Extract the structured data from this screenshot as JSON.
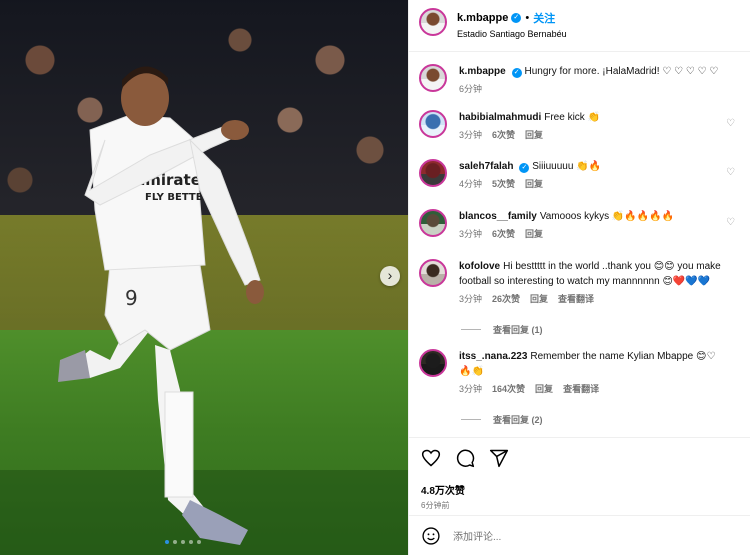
{
  "post": {
    "author": "k.mbappe",
    "follow_label": "关注",
    "separator": "•",
    "location": "Estadio Santiago Bernabéu",
    "caption": "Hungry for more. ¡HalaMadrid! ♡ ♡ ♡ ♡ ♡",
    "caption_time": "6分钟"
  },
  "comments": [
    {
      "user": "habibialmahmudi",
      "verified": false,
      "text": "Free kick 👏",
      "time": "3分钟",
      "likes": "6次赞",
      "reply": "回复"
    },
    {
      "user": "saleh7falah",
      "verified": true,
      "text": "Siiiuuuuu 👏🔥",
      "time": "4分钟",
      "likes": "5次赞",
      "reply": "回复"
    },
    {
      "user": "blancos__family",
      "verified": false,
      "text": "Vamooos kykys 👏🔥🔥🔥🔥",
      "time": "3分钟",
      "likes": "6次赞",
      "reply": "回复"
    },
    {
      "user": "kofolove",
      "verified": false,
      "text": "Hi besttttt in the world ..thank you 😊😊 you make football so interesting to watch my mannnnnn 😊❤️💙💙",
      "time": "3分钟",
      "likes": "26次赞",
      "reply": "回复",
      "translate": "查看翻译",
      "view_replies": "查看回复 (1)"
    },
    {
      "user": "itss_.nana.223",
      "verified": false,
      "text": "Remember the name Kylian Mbappe 😊♡🔥👏",
      "time": "3分钟",
      "likes": "164次赞",
      "reply": "回复",
      "translate": "查看翻译",
      "view_replies": "查看回复 (2)"
    }
  ],
  "footer": {
    "likes": "4.8万次赞",
    "time": "6分钟前",
    "add_comment_placeholder": "添加评论..."
  },
  "colors": {
    "accent": "#0095f6",
    "muted": "#737373",
    "border": "#efefef"
  },
  "icons": {
    "like": "heart-icon",
    "comment": "comment-icon",
    "share": "share-icon",
    "next": "chevron-right-icon",
    "emoji": "emoji-icon",
    "verified": "verified-badge-icon"
  }
}
